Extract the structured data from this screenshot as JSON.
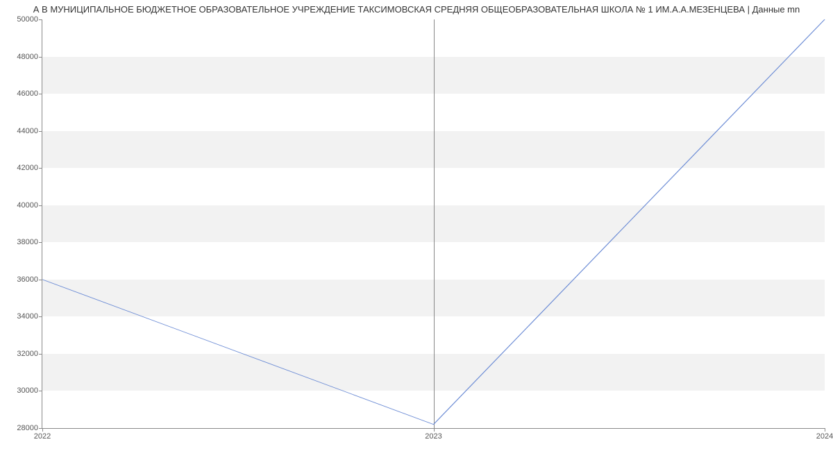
{
  "title": "А В МУНИЦИПАЛЬНОЕ БЮДЖЕТНОЕ ОБРАЗОВАТЕЛЬНОЕ УЧРЕЖДЕНИЕ ТАКСИМОВСКАЯ СРЕДНЯЯ ОБЩЕОБРАЗОВАТЕЛЬНАЯ ШКОЛА № 1 ИМ.А.А.МЕЗЕНЦЕВА | Данные mn",
  "chart_data": {
    "type": "line",
    "x": [
      2022,
      2023,
      2024
    ],
    "values": [
      36000,
      28200,
      50000
    ],
    "title": "А В МУНИЦИПАЛЬНОЕ БЮДЖЕТНОЕ ОБРАЗОВАТЕЛЬНОЕ УЧРЕЖДЕНИЕ ТАКСИМОВСКАЯ СРЕДНЯЯ ОБЩЕОБРАЗОВАТЕЛЬНАЯ ШКОЛА № 1 ИМ.А.А.МЕЗЕНЦЕВА | Данные mn",
    "xlabel": "",
    "ylabel": "",
    "ylim": [
      28000,
      50000
    ],
    "yticks": [
      28000,
      30000,
      32000,
      34000,
      36000,
      38000,
      40000,
      42000,
      44000,
      46000,
      48000,
      50000
    ],
    "xticks": [
      2022,
      2023,
      2024
    ]
  },
  "colors": {
    "line": "#6c8cd5",
    "band": "#f2f2f2",
    "axis": "#888888"
  }
}
